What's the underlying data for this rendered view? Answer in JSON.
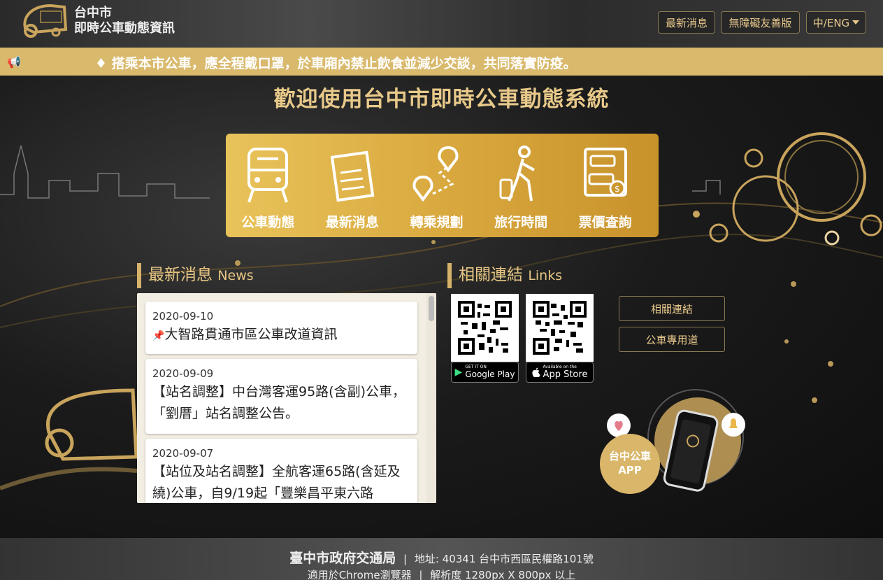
{
  "header": {
    "logo_text_line1": "台中市",
    "logo_text_line2": "即時公車動態資訊",
    "nav_news": "最新消息",
    "nav_accessible": "無障礙友善版",
    "nav_language": "中/ENG"
  },
  "announcement": {
    "text": "♦ 搭乘本市公車，應全程戴口罩，於車廂內禁止飲食並減少交談，共同落實防疫。"
  },
  "welcome": "歡迎使用台中市即時公車動態系統",
  "features": [
    {
      "label": "公車動態",
      "icon": "bus-icon"
    },
    {
      "label": "最新消息",
      "icon": "newspaper-icon"
    },
    {
      "label": "轉乘規劃",
      "icon": "route-icon"
    },
    {
      "label": "旅行時間",
      "icon": "traveler-icon"
    },
    {
      "label": "票價查詢",
      "icon": "fare-ticket-icon"
    }
  ],
  "news_section": {
    "title": "最新消息",
    "title_en": "News",
    "items": [
      {
        "date": "2020-09-10",
        "title": "大智路貫通市區公車改道資訊",
        "pinned": true
      },
      {
        "date": "2020-09-09",
        "title": "【站名調整】中台灣客運95路(含副)公車，「劉厝」站名調整公告。",
        "pinned": false
      },
      {
        "date": "2020-09-07",
        "title": "【站位及站名調整】全航客運65路(含延及繞)公車，自9/19起「豐樂昌平東六路",
        "pinned": false
      }
    ]
  },
  "links_section": {
    "title": "相關連結",
    "title_en": "Links",
    "google_play_small": "GET IT ON",
    "google_play": "Google Play",
    "app_store_small": "Available on the",
    "app_store": "App Store",
    "link_related": "相關連結",
    "link_bus_lane": "公車專用道",
    "app_promo_line1": "台中公車",
    "app_promo_line2": "APP"
  },
  "footer": {
    "org": "臺中市政府交通局",
    "separator": "|",
    "address": "地址: 40341 台中市西區民權路101號",
    "browser": "適用於Chrome瀏覽器",
    "resolution": "解析度 1280px X 800px 以上"
  },
  "colors": {
    "gold": "#e6c684",
    "marquee_bg": "#d9b96c",
    "feature_bar": "#d9a93f"
  }
}
